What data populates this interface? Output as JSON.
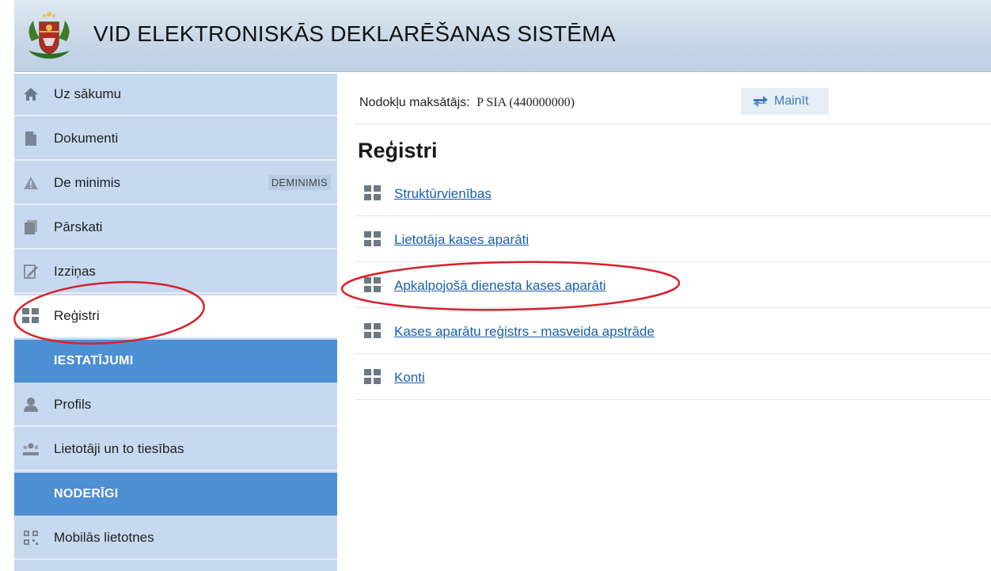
{
  "header": {
    "title": "VID ELEKTRONISKĀS DEKLARĒŠANAS SISTĒMA"
  },
  "sidebar": {
    "items": [
      {
        "label": "Uz sākumu",
        "icon": "home-icon"
      },
      {
        "label": "Dokumenti",
        "icon": "document-icon"
      },
      {
        "label": "De minimis",
        "icon": "warning-icon",
        "badge": "DEMINIMIS"
      },
      {
        "label": "Pārskati",
        "icon": "reports-icon"
      },
      {
        "label": "Izziņas",
        "icon": "certificate-icon"
      },
      {
        "label": "Reģistri",
        "icon": "grid-icon",
        "active": true
      }
    ],
    "section_settings": "IESTATĪJUMI",
    "settings_items": [
      {
        "label": "Profils",
        "icon": "user-icon"
      },
      {
        "label": "Lietotāji un to tiesības",
        "icon": "users-icon"
      }
    ],
    "section_useful": "NODERĪGI",
    "useful_items": [
      {
        "label": "Mobilās lietotnes",
        "icon": "qr-code-icon"
      }
    ]
  },
  "main": {
    "taxpayer_label": "Nodokļu maksātājs:",
    "taxpayer_value": "P SIA (440000000)",
    "change_button": "Mainīt",
    "page_title": "Reģistri",
    "registries": [
      "Struktūrvienības",
      "Lietotāja kases aparāti",
      "Apkalpojošā dienesta kases aparāti",
      "Kases aparātu reģistrs - masveida apstrāde",
      "Konti"
    ]
  },
  "colors": {
    "sidebar_bg": "#c6d9ef",
    "section_bg": "#4d8fd3",
    "link": "#1b5faa",
    "annotation": "#d9202a"
  }
}
